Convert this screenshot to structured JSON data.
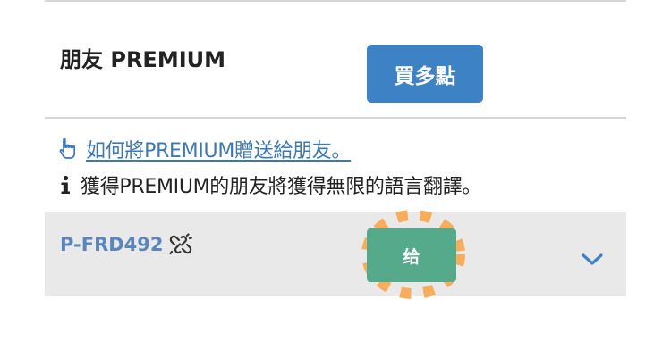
{
  "premium_section": {
    "title": "朋友 PREMIUM",
    "buy_button_label": "買多點"
  },
  "help": {
    "link_text": "如何將PREMIUM贈送給朋友。",
    "info_text": "獲得PREMIUM的朋友將獲得無限的語言翻譯。"
  },
  "gift_code": {
    "code": "P-FRD492",
    "give_button_label": "给"
  },
  "icons": {
    "link_icon": "hand-pointer-icon",
    "info_icon": "info-icon",
    "code_icon": "unlink-icon",
    "expand_icon": "chevron-down-icon"
  },
  "colors": {
    "primary_button": "#3d82c4",
    "give_button": "#55aa8c",
    "link": "#3a78b8",
    "code": "#5a86bb",
    "highlight": "#f7ad5a",
    "panel_bg": "#e9e9e9"
  }
}
